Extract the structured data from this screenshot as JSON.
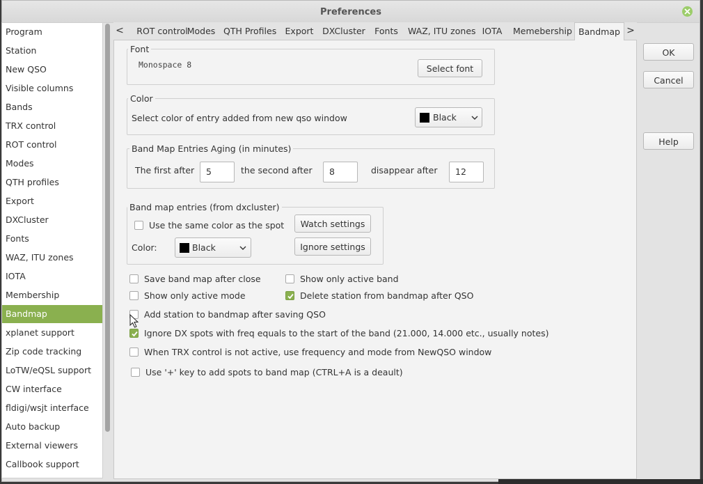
{
  "window": {
    "title": "Preferences"
  },
  "sidebar": {
    "items": [
      {
        "label": "Program"
      },
      {
        "label": "Station"
      },
      {
        "label": "New QSO"
      },
      {
        "label": "Visible columns"
      },
      {
        "label": "Bands"
      },
      {
        "label": "TRX control"
      },
      {
        "label": "ROT control"
      },
      {
        "label": "Modes"
      },
      {
        "label": "QTH profiles"
      },
      {
        "label": "Export"
      },
      {
        "label": "DXCluster"
      },
      {
        "label": "Fonts"
      },
      {
        "label": "WAZ, ITU zones"
      },
      {
        "label": "IOTA"
      },
      {
        "label": "Membership"
      },
      {
        "label": "Bandmap"
      },
      {
        "label": "xplanet support"
      },
      {
        "label": "Zip code tracking"
      },
      {
        "label": "LoTW/eQSL support"
      },
      {
        "label": "CW interface"
      },
      {
        "label": "fldigi/wsjt interface"
      },
      {
        "label": "Auto backup"
      },
      {
        "label": "External viewers"
      },
      {
        "label": "Callbook support"
      }
    ],
    "active": "Bandmap"
  },
  "tabs": {
    "items": [
      {
        "label": "ROT control"
      },
      {
        "label": "Modes"
      },
      {
        "label": "QTH Profiles"
      },
      {
        "label": "Export"
      },
      {
        "label": "DXCluster"
      },
      {
        "label": "Fonts"
      },
      {
        "label": "WAZ, ITU zones"
      },
      {
        "label": "IOTA"
      },
      {
        "label": "Memebership"
      },
      {
        "label": "Bandmap"
      }
    ],
    "left_arrow": "<",
    "right_arrow": ">",
    "active": "Bandmap"
  },
  "font_group": {
    "title": "Font",
    "current": "Monospace 8",
    "select_button": "Select font"
  },
  "color_group": {
    "title": "Color",
    "description": "Select color of entry added from new qso window",
    "value": "Black",
    "swatch": "#000000"
  },
  "aging_group": {
    "title": "Band Map Entries Aging (in minutes)",
    "first_label": "The first after",
    "first_value": "5",
    "second_label": "the second after",
    "second_value": "8",
    "disappear_label": "disappear after",
    "disappear_value": "12"
  },
  "dx_group": {
    "title": "Band map entries (from dxcluster)",
    "same_color_label": "Use the same color as the spot",
    "same_color_checked": false,
    "color_label": "Color:",
    "color_value": "Black",
    "watch_button": "Watch settings",
    "ignore_button": "Ignore settings"
  },
  "options": {
    "save_after_close": {
      "label": "Save band map after close",
      "checked": false
    },
    "only_active_band": {
      "label": "Show only active band",
      "checked": false
    },
    "only_active_mode": {
      "label": "Show only active mode",
      "checked": false
    },
    "delete_after_qso": {
      "label": "Delete station from bandmap after QSO",
      "checked": true
    },
    "add_after_saving": {
      "label": "Add station to bandmap after saving QSO",
      "checked": false
    },
    "ignore_band_start": {
      "label": "Ignore DX spots with freq equals to the start of the band (21.000, 14.000 etc., usually notes)",
      "checked": true
    },
    "trx_inactive": {
      "label": "When TRX control is not active, use frequency and mode from NewQSO window",
      "checked": false
    },
    "plus_key": {
      "label": "Use '+' key to add spots to band map (CTRL+A is a deault)",
      "checked": false
    }
  },
  "dialog_buttons": {
    "ok": "OK",
    "cancel": "Cancel",
    "help": "Help"
  },
  "colors": {
    "accent": "#8ab04f",
    "background": "#f3f3f3"
  }
}
